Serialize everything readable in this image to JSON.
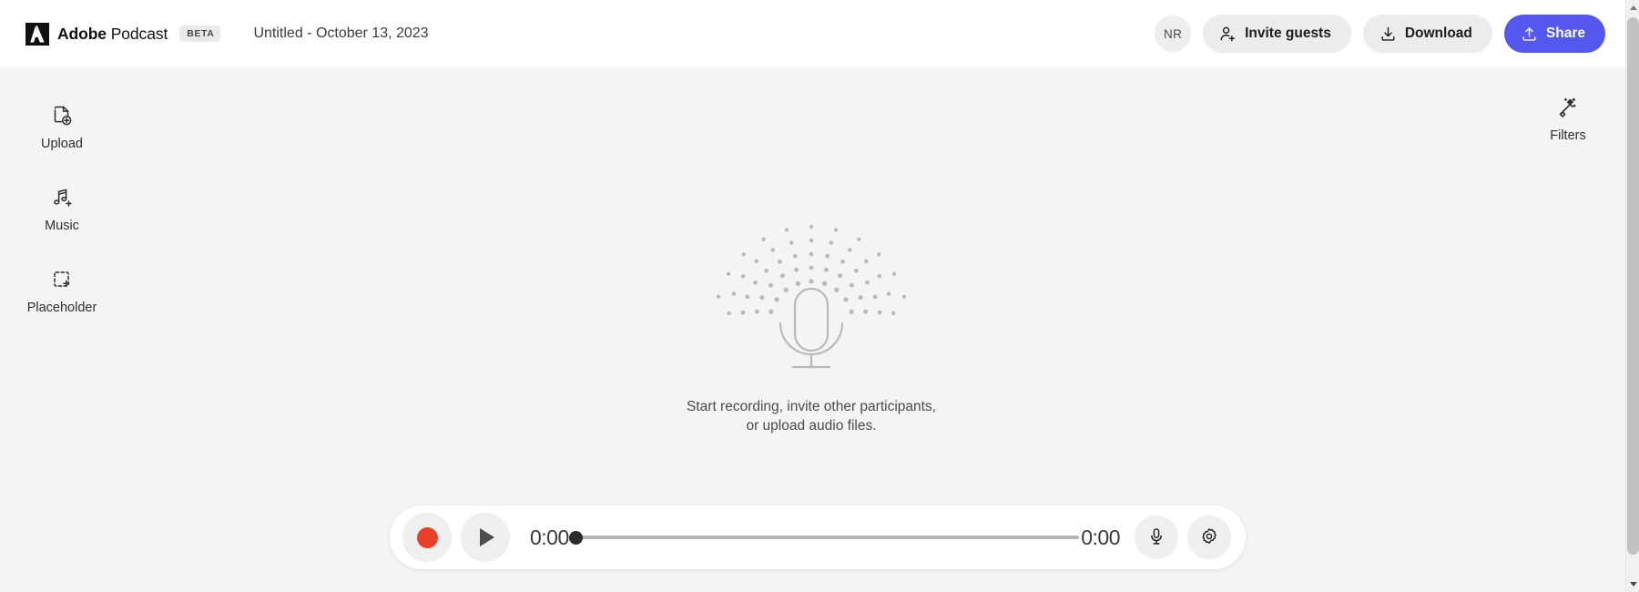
{
  "colors": {
    "page_bg": "#f4f4f4",
    "header_bg": "#ffffff",
    "accent_primary": "#5458ee",
    "record_red": "#e8402a",
    "ghost_button_bg": "#ececec",
    "art_gray": "#b9b9b9"
  },
  "header": {
    "brand_name_bold": "Adobe",
    "brand_name_light": " Podcast",
    "beta_label": "BETA",
    "document_title": "Untitled - October 13, 2023",
    "avatar_initials": "NR",
    "invite_label": "Invite guests",
    "download_label": "Download",
    "share_label": "Share",
    "logo_icon": "adobe-logo-icon",
    "invite_icon": "add-person-icon",
    "download_icon": "download-icon",
    "share_icon": "share-upload-icon"
  },
  "left_rail": {
    "items": [
      {
        "label": "Upload",
        "icon": "file-add-icon"
      },
      {
        "label": "Music",
        "icon": "music-note-add-icon"
      },
      {
        "label": "Placeholder",
        "icon": "dashed-box-add-icon"
      }
    ]
  },
  "right_rail": {
    "label": "Filters",
    "icon": "magic-wand-icon"
  },
  "stage": {
    "art_icon": "microphone-with-sound-dots-icon",
    "empty_line_1": "Start recording, invite other participants,",
    "empty_line_2": "or upload audio files."
  },
  "player": {
    "record_label": "Record",
    "record_icon": "record-circle-icon",
    "play_label": "Play",
    "play_icon": "play-triangle-icon",
    "current_time": "0:00",
    "total_time": "0:00",
    "progress_percent": 0,
    "mic_label": "Microphone",
    "mic_icon": "microphone-icon",
    "settings_label": "Settings",
    "settings_icon": "gear-icon"
  },
  "scrollbar": {
    "up_icon": "scroll-up-arrow-icon",
    "down_icon": "scroll-down-arrow-icon"
  }
}
